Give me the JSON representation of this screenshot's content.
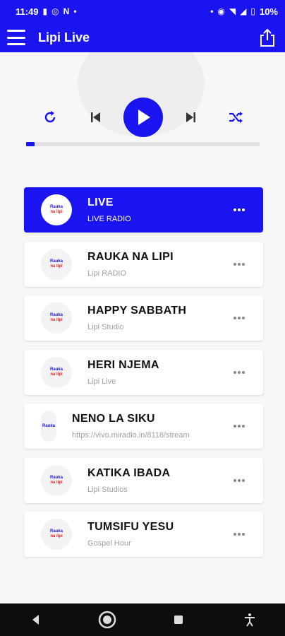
{
  "status_bar": {
    "time": "11:49",
    "battery": "10%",
    "left_icons": [
      "sim-icon",
      "whatsapp-icon",
      "notification-icon",
      "dot-icon"
    ],
    "right_icons": [
      "dot-icon",
      "hotspot-icon",
      "wifi-icon",
      "signal-icon",
      "signal-icon",
      "battery-icon"
    ]
  },
  "app_bar": {
    "title": "Lipi Live"
  },
  "player": {
    "progress": 0.035
  },
  "stations": [
    {
      "title": "LIVE",
      "subtitle": "LIVE RADIO",
      "active": true
    },
    {
      "title": "RAUKA NA LIPI",
      "subtitle": "Lipi RADIO",
      "active": false
    },
    {
      "title": "HAPPY SABBATH",
      "subtitle": "Lipi Studio",
      "active": false
    },
    {
      "title": "HERI NJEMA",
      "subtitle": "Lipi Live",
      "active": false
    },
    {
      "title": "NENO LA SIKU",
      "subtitle": "https://vivo.miradio.in/8118/stream",
      "active": false
    },
    {
      "title": "KATIKA IBADA",
      "subtitle": "Lipi Studios",
      "active": false
    },
    {
      "title": "TUMSIFU YESU",
      "subtitle": "Gospel Hour",
      "active": false
    }
  ],
  "logo_text": {
    "line1": "Rauka",
    "line2": "na lipi"
  },
  "colors": {
    "accent": "#1a14f0",
    "navbar": "#0d0d0d"
  }
}
